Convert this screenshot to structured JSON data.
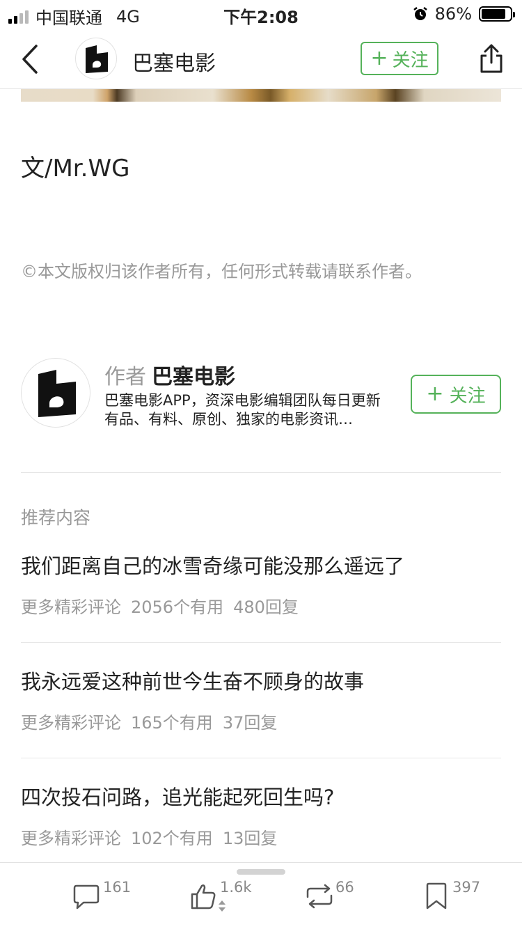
{
  "status_bar": {
    "carrier": "中国联通",
    "network": "4G",
    "time": "下午2:08",
    "battery": "86%",
    "battery_level": 0.86
  },
  "navbar": {
    "title": "巴塞电影",
    "follow_label": "关注"
  },
  "article": {
    "byline": "文/Mr.WG",
    "copyright": "©本文版权归该作者所有，任何形式转载请联系作者。"
  },
  "author": {
    "label": "作者",
    "name": "巴塞电影",
    "description": "巴塞电影APP，资深电影编辑团队每日更新有品、有料、原创、独家的电影资讯…",
    "follow_label": "关注"
  },
  "recommend": {
    "title": "推荐内容",
    "items": [
      {
        "title": "我们距离自己的冰雪奇缘可能没那么遥远了",
        "tag": "更多精彩评论",
        "useful": "2056个有用",
        "replies": "480回复"
      },
      {
        "title": "我永远爱这种前世今生奋不顾身的故事",
        "tag": "更多精彩评论",
        "useful": "165个有用",
        "replies": "37回复"
      },
      {
        "title": "四次投石问路，追光能起死回生吗?",
        "tag": "更多精彩评论",
        "useful": "102个有用",
        "replies": "13回复"
      }
    ]
  },
  "toolbar": {
    "comments": "161",
    "likes": "1.6k",
    "reposts": "66",
    "bookmarks": "397"
  },
  "colors": {
    "accent": "#55b25a",
    "muted": "#999999"
  },
  "icons": [
    "back-icon",
    "follow-plus-icon",
    "share-icon",
    "comment-icon",
    "like-icon",
    "repost-icon",
    "bookmark-icon"
  ]
}
